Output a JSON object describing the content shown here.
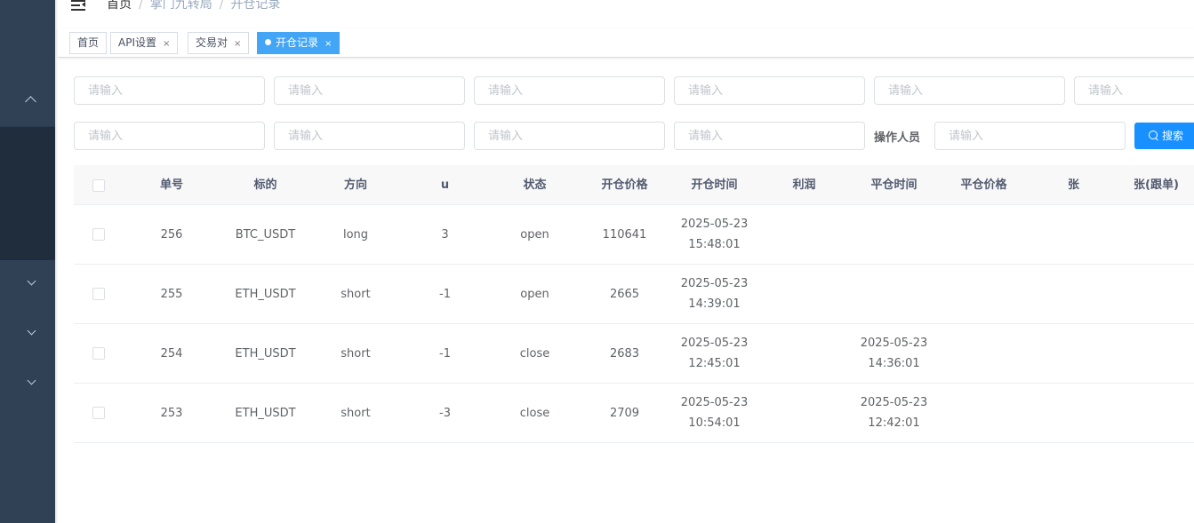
{
  "header": {
    "breadcrumb": {
      "home": "首页",
      "sep1": "/",
      "parent": "掌门九转局",
      "sep2": "/",
      "current": "开仓记录"
    }
  },
  "tags": [
    {
      "label": "首页"
    },
    {
      "label": "API设置",
      "close": "×"
    },
    {
      "label": "交易对",
      "close": "×"
    },
    {
      "label": "开仓记录",
      "close": "×",
      "active": true
    }
  ],
  "filters": {
    "placeholder": "请输入",
    "operator_label": "操作人员",
    "search_label": "搜索"
  },
  "table": {
    "columns": [
      "单号",
      "标的",
      "方向",
      "u",
      "状态",
      "开仓价格",
      "开仓时间",
      "利润",
      "平仓时间",
      "平仓价格",
      "张",
      "张(跟单)"
    ],
    "rows": [
      {
        "id": "256",
        "symbol": "BTC_USDT",
        "direction": "long",
        "u": "3",
        "status": "open",
        "open_price": "110641",
        "open_date": "2025-05-23",
        "open_time": "15:48:01",
        "profit": "",
        "close_date": "",
        "close_time": "",
        "close_price": "",
        "qty": "",
        "qty_follow": ""
      },
      {
        "id": "255",
        "symbol": "ETH_USDT",
        "direction": "short",
        "u": "-1",
        "status": "open",
        "open_price": "2665",
        "open_date": "2025-05-23",
        "open_time": "14:39:01",
        "profit": "",
        "close_date": "",
        "close_time": "",
        "close_price": "",
        "qty": "",
        "qty_follow": ""
      },
      {
        "id": "254",
        "symbol": "ETH_USDT",
        "direction": "short",
        "u": "-1",
        "status": "close",
        "open_price": "2683",
        "open_date": "2025-05-23",
        "open_time": "12:45:01",
        "profit": "",
        "close_date": "2025-05-23",
        "close_time": "14:36:01",
        "close_price": "",
        "qty": "",
        "qty_follow": ""
      },
      {
        "id": "253",
        "symbol": "ETH_USDT",
        "direction": "short",
        "u": "-3",
        "status": "close",
        "open_price": "2709",
        "open_date": "2025-05-23",
        "open_time": "10:54:01",
        "profit": "",
        "close_date": "2025-05-23",
        "close_time": "12:42:01",
        "close_price": "",
        "qty": "",
        "qty_follow": ""
      }
    ]
  },
  "icons": {
    "menu_toggle": "hamburger-icon",
    "sidebar_expand": "chevron-up-icon",
    "sidebar_collapse": "chevron-down-icon",
    "tag_active": "dot-icon",
    "search": "search-icon"
  },
  "colors": {
    "sidebar_bg": "#304156",
    "sidebar_active_bg": "#1f2d3d",
    "tag_active": "#42a5f5",
    "primary": "#1890ff",
    "table_header_bg": "#f8f8f9"
  }
}
